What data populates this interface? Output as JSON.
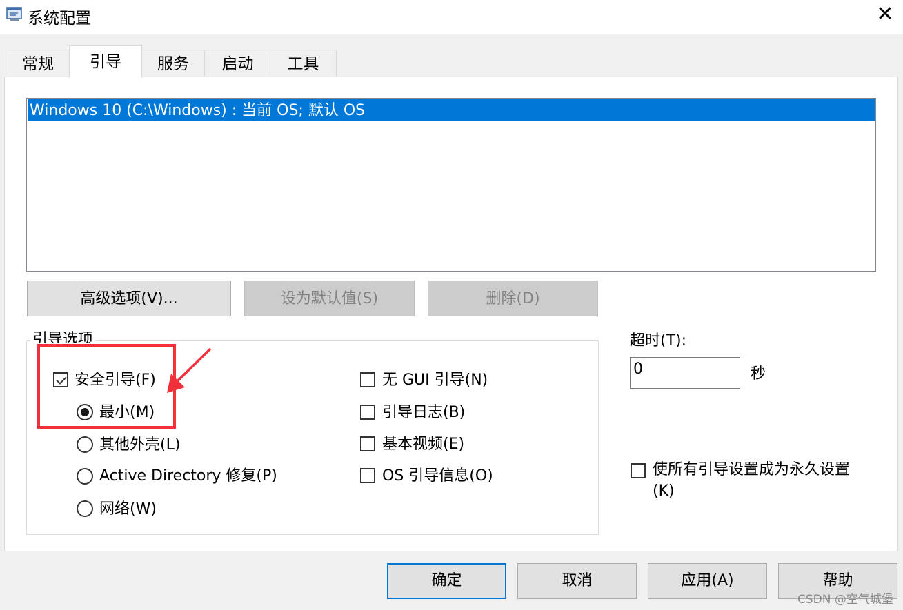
{
  "window": {
    "title": "系统配置",
    "close_glyph": "✕",
    "app_icon": "msconfig-icon"
  },
  "tabs": [
    {
      "label": "常规",
      "active": false
    },
    {
      "label": "引导",
      "active": true
    },
    {
      "label": "服务",
      "active": false
    },
    {
      "label": "启动",
      "active": false
    },
    {
      "label": "工具",
      "active": false
    }
  ],
  "os_list": {
    "items": [
      {
        "label": "Windows 10 (C:\\Windows) : 当前 OS; 默认 OS",
        "selected": true
      }
    ]
  },
  "list_buttons": {
    "advanced": {
      "label": "高级选项(V)...",
      "enabled": true
    },
    "set_default": {
      "label": "设为默认值(S)",
      "enabled": false
    },
    "delete": {
      "label": "删除(D)",
      "enabled": false
    }
  },
  "boot_options": {
    "legend": "引导选项",
    "safe_boot": {
      "label": "安全引导(F)",
      "checked": true
    },
    "radios": [
      {
        "label": "最小(M)",
        "checked": true
      },
      {
        "label": "其他外壳(L)",
        "checked": false
      },
      {
        "label": "Active Directory 修复(P)",
        "checked": false
      },
      {
        "label": "网络(W)",
        "checked": false
      }
    ],
    "checkboxes": [
      {
        "label": "无 GUI 引导(N)",
        "checked": false
      },
      {
        "label": "引导日志(B)",
        "checked": false
      },
      {
        "label": "基本视频(E)",
        "checked": false
      },
      {
        "label": "OS 引导信息(O)",
        "checked": false
      }
    ]
  },
  "timeout": {
    "label": "超时(T):",
    "value": "0",
    "unit": "秒"
  },
  "permanent": {
    "label_line1": "使所有引导设置成为永久设置",
    "label_line2": "(K)",
    "checked": false
  },
  "footer_buttons": {
    "ok": "确定",
    "cancel": "取消",
    "apply": "应用(A)",
    "help": "帮助"
  },
  "annotation": {
    "color": "#f0303a"
  },
  "watermark": "CSDN @空气城堡",
  "colors": {
    "selection": "#0078d7",
    "button": "#e1e1e1",
    "button_disabled": "#cccccc"
  }
}
